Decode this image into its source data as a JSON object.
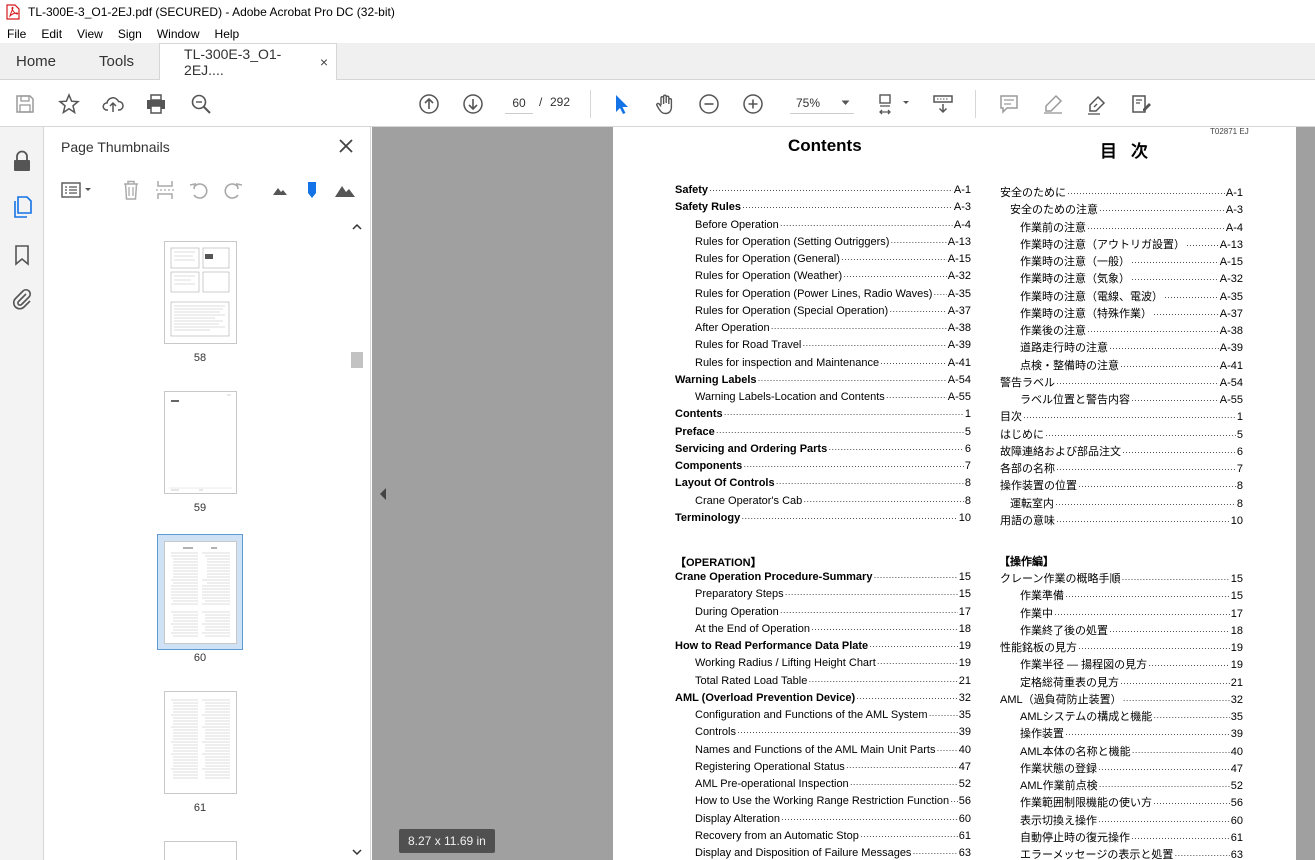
{
  "window": {
    "title": "TL-300E-3_O1-2EJ.pdf (SECURED) - Adobe Acrobat Pro DC (32-bit)"
  },
  "menu": [
    "File",
    "Edit",
    "View",
    "Sign",
    "Window",
    "Help"
  ],
  "tabs": {
    "home": "Home",
    "tools": "Tools",
    "document": "TL-300E-3_O1-2EJ....",
    "close": "×"
  },
  "toolbar": {
    "page_current": "60",
    "page_separator": "/",
    "page_total": "292",
    "zoom": "75%"
  },
  "thumbnails": {
    "title": "Page Thumbnails",
    "pages": [
      "58",
      "59",
      "60",
      "61"
    ],
    "selected": "60"
  },
  "document": {
    "page_size": "8.27 x 11.69 in",
    "page_code": "T02871 EJ",
    "heading_en": "Contents",
    "heading_jp": "目次",
    "section_en": "【OPERATION】",
    "section_jp": "【操作編】",
    "toc_en": [
      {
        "text": "Safety",
        "page": "A-1",
        "bold": true,
        "indent": 0
      },
      {
        "text": "Safety Rules",
        "page": "A-3",
        "bold": true,
        "indent": 0
      },
      {
        "text": "Before Operation",
        "page": "A-4",
        "bold": false,
        "indent": 1
      },
      {
        "text": "Rules for Operation (Setting Outriggers)",
        "page": "A-13",
        "bold": false,
        "indent": 1
      },
      {
        "text": "Rules for Operation (General)",
        "page": "A-15",
        "bold": false,
        "indent": 1
      },
      {
        "text": "Rules for Operation (Weather)",
        "page": "A-32",
        "bold": false,
        "indent": 1
      },
      {
        "text": "Rules for Operation (Power Lines, Radio Waves)",
        "page": "A-35",
        "bold": false,
        "indent": 1
      },
      {
        "text": "Rules for Operation (Special Operation)",
        "page": "A-37",
        "bold": false,
        "indent": 1
      },
      {
        "text": "After Operation",
        "page": "A-38",
        "bold": false,
        "indent": 1
      },
      {
        "text": "Rules for Road Travel",
        "page": "A-39",
        "bold": false,
        "indent": 1
      },
      {
        "text": "Rules for inspection and Maintenance",
        "page": "A-41",
        "bold": false,
        "indent": 1
      },
      {
        "text": "Warning Labels",
        "page": "A-54",
        "bold": true,
        "indent": 0
      },
      {
        "text": "Warning Labels-Location and Contents",
        "page": "A-55",
        "bold": false,
        "indent": 1
      },
      {
        "text": "Contents",
        "page": "1",
        "bold": true,
        "indent": 0
      },
      {
        "text": "Preface",
        "page": "5",
        "bold": true,
        "indent": 0
      },
      {
        "text": "Servicing and Ordering Parts",
        "page": "6",
        "bold": true,
        "indent": 0
      },
      {
        "text": "Components",
        "page": "7",
        "bold": true,
        "indent": 0
      },
      {
        "text": "Layout Of Controls",
        "page": "8",
        "bold": true,
        "indent": 0
      },
      {
        "text": "Crane Operator's Cab",
        "page": "8",
        "bold": false,
        "indent": 1
      },
      {
        "text": "Terminology",
        "page": "10",
        "bold": true,
        "indent": 0
      }
    ],
    "toc_jp": [
      {
        "text": "安全のために",
        "page": "A-1",
        "indent": 0
      },
      {
        "text": "安全のための注意",
        "page": "A-3",
        "indent": 1
      },
      {
        "text": "作業前の注意",
        "page": "A-4",
        "indent": 2
      },
      {
        "text": "作業時の注意（アウトリガ設置）",
        "page": "A-13",
        "indent": 2
      },
      {
        "text": "作業時の注意（一般）",
        "page": "A-15",
        "indent": 2
      },
      {
        "text": "作業時の注意（気象）",
        "page": "A-32",
        "indent": 2
      },
      {
        "text": "作業時の注意（電線、電波）",
        "page": "A-35",
        "indent": 2
      },
      {
        "text": "作業時の注意（特殊作業）",
        "page": "A-37",
        "indent": 2
      },
      {
        "text": "作業後の注意",
        "page": "A-38",
        "indent": 2
      },
      {
        "text": "道路走行時の注意",
        "page": "A-39",
        "indent": 2
      },
      {
        "text": "点検・整備時の注意",
        "page": "A-41",
        "indent": 2
      },
      {
        "text": "警告ラベル",
        "page": "A-54",
        "indent": 0
      },
      {
        "text": "ラベル位置と警告内容",
        "page": "A-55",
        "indent": 2
      },
      {
        "text": "目次",
        "page": "1",
        "indent": 0
      },
      {
        "text": "はじめに",
        "page": "5",
        "indent": 0
      },
      {
        "text": "故障連絡および部品注文",
        "page": "6",
        "indent": 0
      },
      {
        "text": "各部の名称",
        "page": "7",
        "indent": 0
      },
      {
        "text": "操作装置の位置",
        "page": "8",
        "indent": 0
      },
      {
        "text": "運転室内",
        "page": "8",
        "indent": 1
      },
      {
        "text": "用語の意味",
        "page": "10",
        "indent": 0
      }
    ],
    "toc2_en": [
      {
        "text": "Crane Operation Procedure-Summary",
        "page": "15",
        "bold": true,
        "indent": 0
      },
      {
        "text": "Preparatory Steps",
        "page": "15",
        "bold": false,
        "indent": 1
      },
      {
        "text": "During Operation",
        "page": "17",
        "bold": false,
        "indent": 1
      },
      {
        "text": "At the End of Operation",
        "page": "18",
        "bold": false,
        "indent": 1
      },
      {
        "text": "How to Read Performance Data Plate",
        "page": "19",
        "bold": true,
        "indent": 0
      },
      {
        "text": "Working Radius / Lifting Height Chart",
        "page": "19",
        "bold": false,
        "indent": 1
      },
      {
        "text": "Total Rated Load Table",
        "page": "21",
        "bold": false,
        "indent": 1
      },
      {
        "text": "AML (Overload Prevention Device)",
        "page": "32",
        "bold": true,
        "indent": 0
      },
      {
        "text": "Configuration and Functions of the AML System",
        "page": "35",
        "bold": false,
        "indent": 1
      },
      {
        "text": "Controls",
        "page": "39",
        "bold": false,
        "indent": 1
      },
      {
        "text": "Names and Functions of the AML Main Unit Parts",
        "page": "40",
        "bold": false,
        "indent": 1
      },
      {
        "text": "Registering Operational Status",
        "page": "47",
        "bold": false,
        "indent": 1
      },
      {
        "text": "AML Pre-operational Inspection",
        "page": "52",
        "bold": false,
        "indent": 1
      },
      {
        "text": "How to Use the Working Range Restriction Function",
        "page": "56",
        "bold": false,
        "indent": 1
      },
      {
        "text": "Display Alteration",
        "page": "60",
        "bold": false,
        "indent": 1
      },
      {
        "text": "Recovery from an Automatic Stop",
        "page": "61",
        "bold": false,
        "indent": 1
      },
      {
        "text": "Display and Disposition of Failure Messages",
        "page": "63",
        "bold": false,
        "indent": 1
      }
    ],
    "toc2_jp": [
      {
        "text": "クレーン作業の概略手順",
        "page": "15",
        "indent": 0
      },
      {
        "text": "作業準備",
        "page": "15",
        "indent": 1
      },
      {
        "text": "作業中",
        "page": "17",
        "indent": 1
      },
      {
        "text": "作業終了後の処置",
        "page": "18",
        "indent": 1
      },
      {
        "text": "性能銘板の見方",
        "page": "19",
        "indent": 0
      },
      {
        "text": "作業半径 ― 揚程図の見方",
        "page": "19",
        "indent": 1
      },
      {
        "text": "定格総荷重表の見方",
        "page": "21",
        "indent": 1
      },
      {
        "text": "AML（過負荷防止装置）",
        "page": "32",
        "indent": 0
      },
      {
        "text": "AMLシステムの構成と機能",
        "page": "35",
        "indent": 1
      },
      {
        "text": "操作装置",
        "page": "39",
        "indent": 1
      },
      {
        "text": "AML本体の名称と機能",
        "page": "40",
        "indent": 1
      },
      {
        "text": "作業状態の登録",
        "page": "47",
        "indent": 1
      },
      {
        "text": "AML作業前点検",
        "page": "52",
        "indent": 1
      },
      {
        "text": "作業範囲制限機能の使い方",
        "page": "56",
        "indent": 1
      },
      {
        "text": "表示切換え操作",
        "page": "60",
        "indent": 1
      },
      {
        "text": "自動停止時の復元操作",
        "page": "61",
        "indent": 1
      },
      {
        "text": "エラーメッセージの表示と処置",
        "page": "63",
        "indent": 1
      }
    ]
  },
  "colors": {
    "accent": "#1473e6",
    "pdf_red": "#d7191c",
    "doc_bg": "#a0a0a0",
    "selection": "#cfe2f5"
  }
}
